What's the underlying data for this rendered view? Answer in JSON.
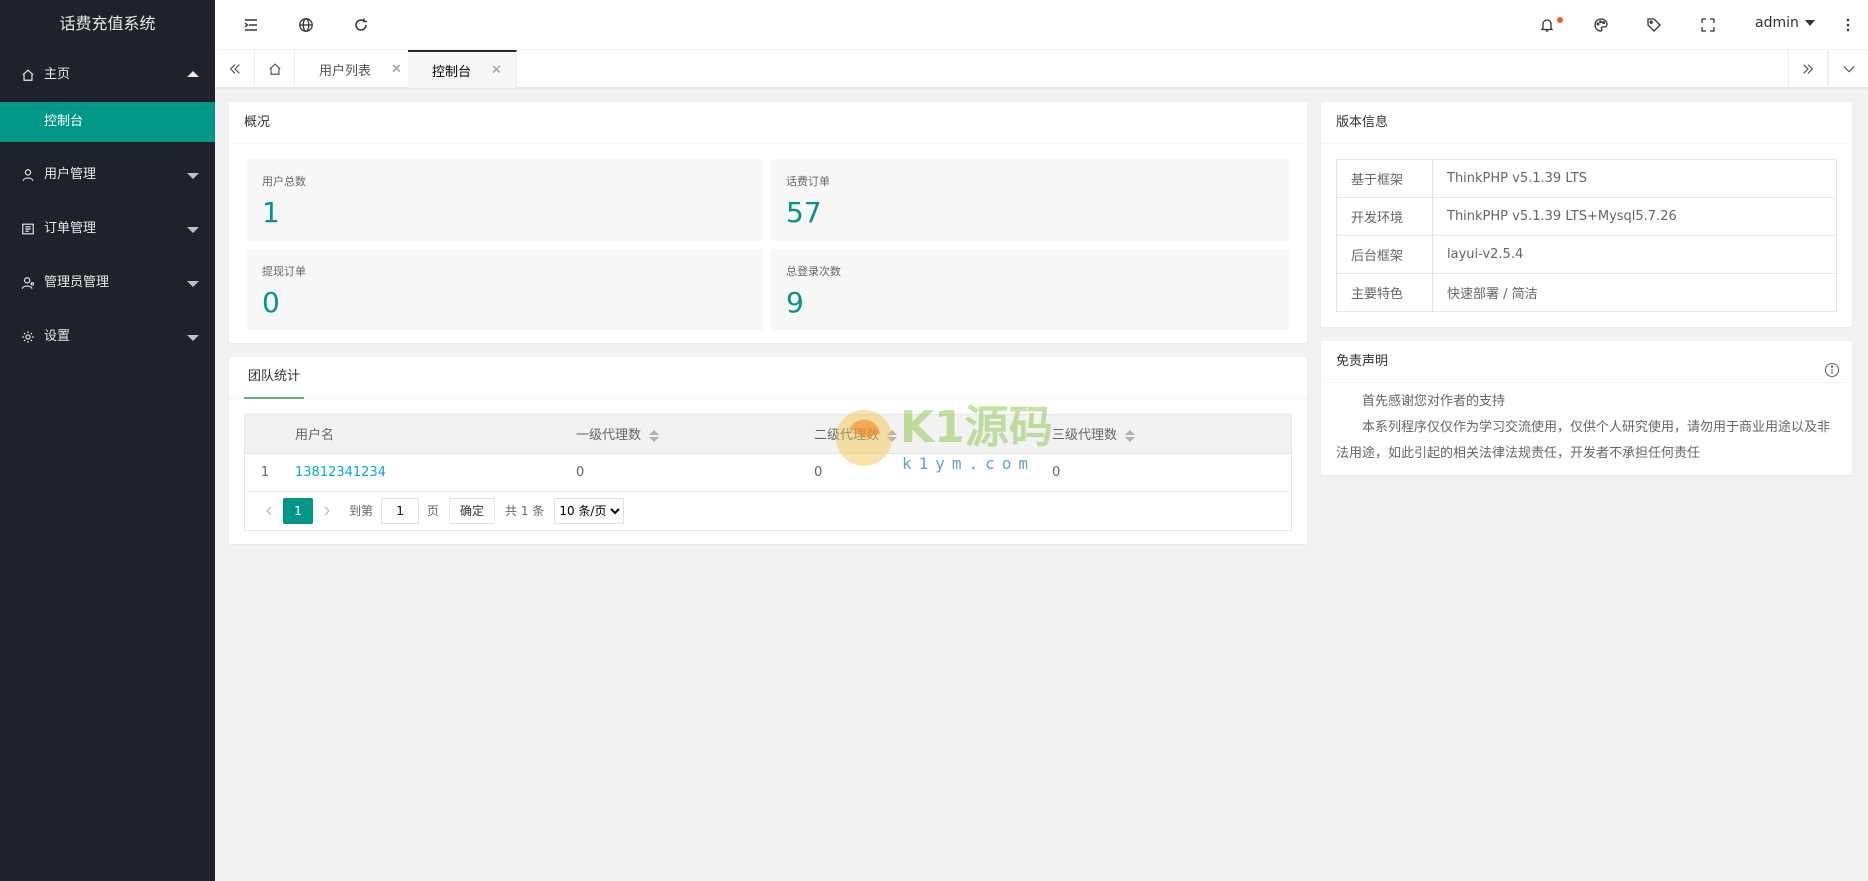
{
  "app": {
    "title": "话费充值系统"
  },
  "sidebar": {
    "items": [
      {
        "label": "主页",
        "icon": "home-icon",
        "expanded": true,
        "children": [
          {
            "label": "控制台"
          }
        ]
      },
      {
        "label": "用户管理",
        "icon": "user-icon"
      },
      {
        "label": "订单管理",
        "icon": "list-icon"
      },
      {
        "label": "管理员管理",
        "icon": "admin-icon"
      },
      {
        "label": "设置",
        "icon": "gear-icon"
      }
    ]
  },
  "header": {
    "icons": [
      "menu-fold-icon",
      "globe-icon",
      "refresh-icon",
      "bell-icon",
      "theme-icon",
      "tag-icon",
      "fullscreen-icon",
      "more-icon"
    ],
    "user": "admin"
  },
  "tabs": [
    {
      "label": "用户列表"
    },
    {
      "label": "控制台",
      "active": true
    }
  ],
  "overview": {
    "title": "概况",
    "stats": [
      {
        "label": "用户总数",
        "value": "1"
      },
      {
        "label": "话费订单",
        "value": "57"
      },
      {
        "label": "提现订单",
        "value": "0"
      },
      {
        "label": "总登录次数",
        "value": "9"
      }
    ]
  },
  "team": {
    "tab": "团队统计",
    "columns": [
      "用户名",
      "一级代理数",
      "二级代理数",
      "三级代理数"
    ],
    "rows": [
      {
        "index": "1",
        "username": "13812341234",
        "l1": "0",
        "l2": "0",
        "l3": "0"
      }
    ],
    "pager": {
      "current": "1",
      "goto_label": "到第",
      "page_input": "1",
      "page_unit": "页",
      "confirm": "确定",
      "total": "共 1 条",
      "per_page": "10 条/页"
    }
  },
  "version": {
    "title": "版本信息",
    "rows": [
      {
        "key": "基于框架",
        "value": "ThinkPHP v5.1.39 LTS"
      },
      {
        "key": "开发环境",
        "value": "ThinkPHP v5.1.39 LTS+Mysql5.7.26"
      },
      {
        "key": "后台框架",
        "value": "layui-v2.5.4"
      },
      {
        "key": "主要特色",
        "value": "快速部署 / 简洁"
      }
    ]
  },
  "disclaimer": {
    "title": "免责声明",
    "lines": [
      "首先感谢您对作者的支持",
      "本系列程序仅仅作为学习交流使用，仅供个人研究使用，请勿用于商业用途以及非法用途，如此引起的相关法律法规责任，开发者不承担任何责任"
    ]
  },
  "watermark": {
    "brand": "K1源码",
    "domain": "k1ym.com"
  },
  "colors": {
    "accent": "#009688",
    "sidebar": "#20222a",
    "link": "#01aaed",
    "notify": "#ff5722"
  }
}
